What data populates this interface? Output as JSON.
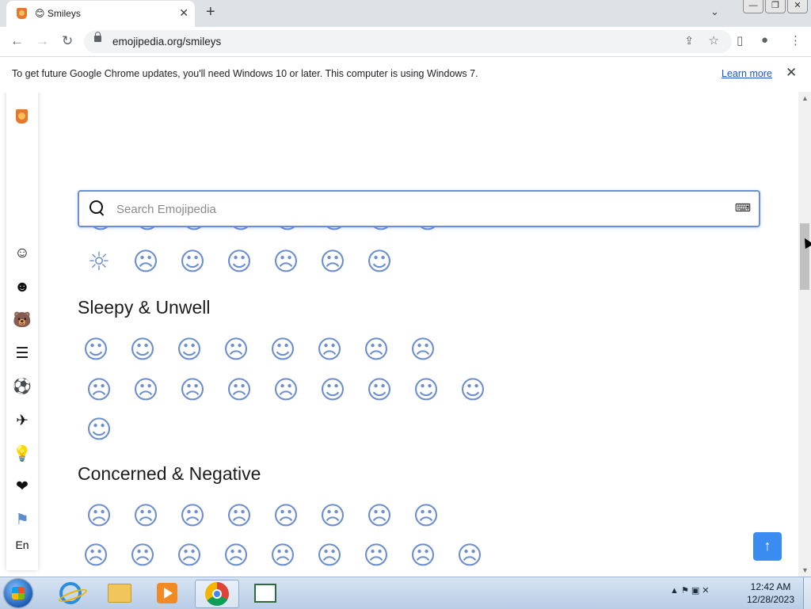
{
  "browser": {
    "tab_title": "😊 Smileys",
    "new_tab": "+",
    "tab_close": "✕",
    "url": "emojipedia.org/smileys",
    "win_controls": [
      "—",
      "❐",
      "✕"
    ]
  },
  "infobar": {
    "message": "To get future Google Chrome updates, you'll need Windows 10 or later. This computer is using Windows 7.",
    "link": "Learn more",
    "close": "✕"
  },
  "sidenav": {
    "items": [
      {
        "name": "smileys",
        "glyph": "☺"
      },
      {
        "name": "people",
        "glyph": "☻"
      },
      {
        "name": "animals",
        "glyph": "🐻"
      },
      {
        "name": "food",
        "glyph": "☰"
      },
      {
        "name": "activities",
        "glyph": "⚽"
      },
      {
        "name": "travel",
        "glyph": "✈"
      },
      {
        "name": "objects",
        "glyph": "💡"
      },
      {
        "name": "symbols",
        "glyph": "❤"
      },
      {
        "name": "flags",
        "glyph": "⚑"
      }
    ],
    "language": "En"
  },
  "search": {
    "placeholder": "Search Emojipedia",
    "keyboard_glyph": "⌨"
  },
  "sections": {
    "partial_row": [
      "☺",
      "☺",
      "☺",
      "☺",
      "☺",
      "☺",
      "☺",
      "☺"
    ],
    "partial_row2": [
      "☼",
      "☹",
      "☺",
      "☺",
      "☹",
      "☹",
      "☺"
    ],
    "sleepy": {
      "title": "Sleepy & Unwell",
      "row1": [
        "☺",
        "☺",
        "☺",
        "☹",
        "☺",
        "☹",
        "☹",
        "☹"
      ],
      "row2": [
        "☹",
        "☹",
        "☹",
        "☹",
        "☹",
        "☺",
        "☺",
        "☺",
        "☺"
      ],
      "row3": [
        "☺"
      ]
    },
    "concerned": {
      "title": "Concerned & Negative",
      "row1": [
        "☹",
        "☹",
        "☹",
        "☹",
        "☹",
        "☹",
        "☹",
        "☹"
      ],
      "row2": [
        "☹",
        "☹",
        "☹",
        "☹",
        "☹",
        "☹",
        "☹",
        "☹",
        "☹"
      ]
    }
  },
  "back_to_top": "↑",
  "taskbar": {
    "time": "12:42 AM",
    "date": "12/28/2023",
    "tray": "▲ ⚑ ▣ ✕"
  }
}
